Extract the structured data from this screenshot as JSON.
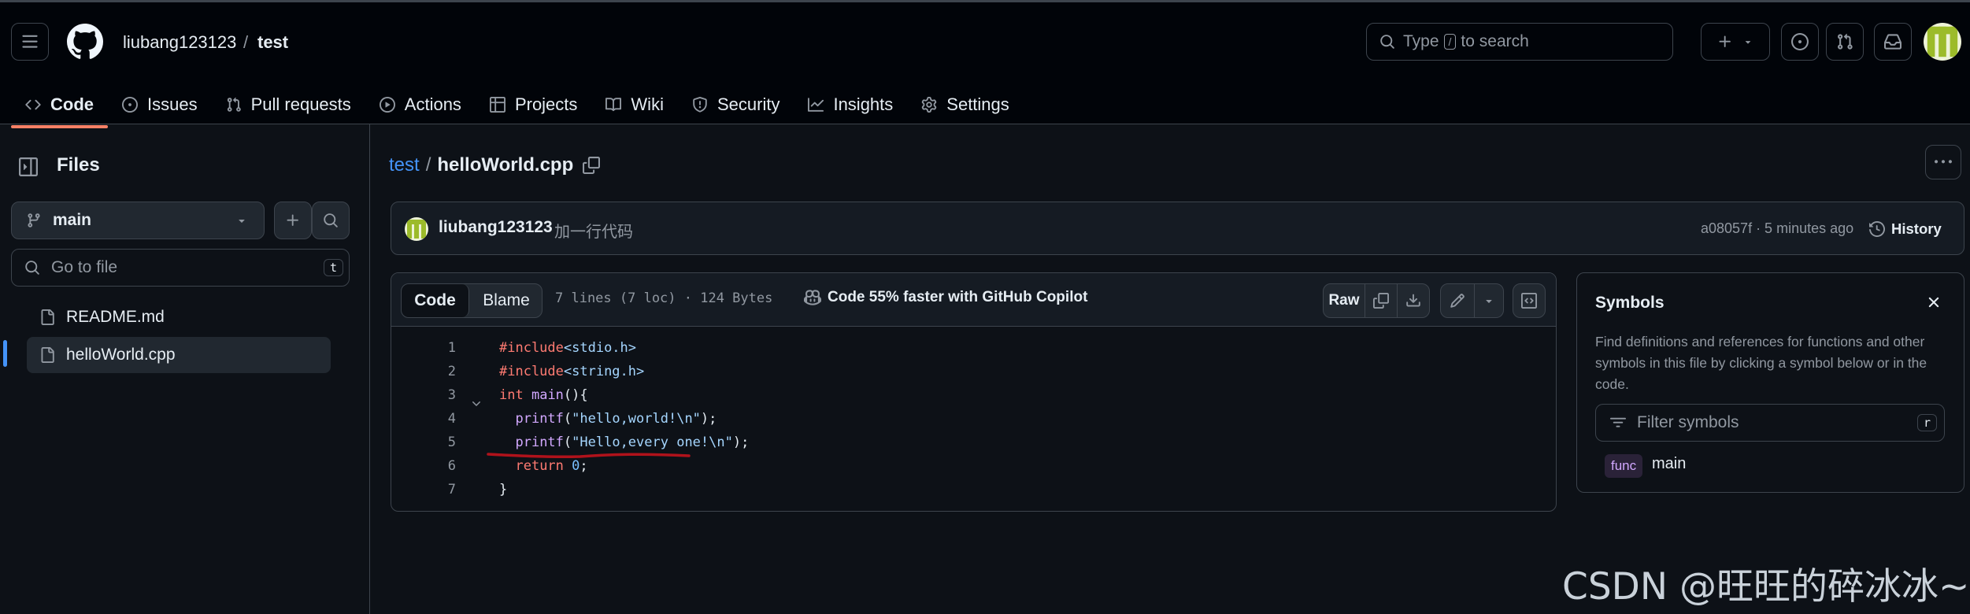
{
  "header": {
    "owner": "liubang123123",
    "separator": "/",
    "repo": "test",
    "search": {
      "prefix": "Type",
      "key": "/",
      "suffix": "to search"
    }
  },
  "tabs": [
    {
      "label": "Code",
      "icon": "code-icon",
      "active": true
    },
    {
      "label": "Issues",
      "icon": "issue-icon"
    },
    {
      "label": "Pull requests",
      "icon": "pull-request-icon"
    },
    {
      "label": "Actions",
      "icon": "play-icon"
    },
    {
      "label": "Projects",
      "icon": "table-icon"
    },
    {
      "label": "Wiki",
      "icon": "book-icon"
    },
    {
      "label": "Security",
      "icon": "shield-icon"
    },
    {
      "label": "Insights",
      "icon": "graph-icon"
    },
    {
      "label": "Settings",
      "icon": "gear-icon"
    }
  ],
  "sidebar": {
    "title": "Files",
    "branch": "main",
    "goto_placeholder": "Go to file",
    "goto_key": "t",
    "files": [
      {
        "name": "README.md",
        "active": false
      },
      {
        "name": "helloWorld.cpp",
        "active": true
      }
    ]
  },
  "path": {
    "repo": "test",
    "separator": "/",
    "file": "helloWorld.cpp"
  },
  "commit": {
    "author": "liubang123123",
    "message": "加一行代码",
    "hash_time": "a08057f · 5 minutes ago",
    "history_label": "History"
  },
  "code_view": {
    "tab_code": "Code",
    "tab_blame": "Blame",
    "meta": "7 lines (7 loc) · 124 Bytes",
    "copilot": "Code 55% faster with GitHub Copilot",
    "raw_label": "Raw",
    "lines": [
      {
        "n": "1",
        "tokens": [
          [
            "pp",
            "#include"
          ],
          [
            "hdr",
            "<stdio.h>"
          ]
        ]
      },
      {
        "n": "2",
        "tokens": [
          [
            "pp",
            "#include"
          ],
          [
            "hdr",
            "<string.h>"
          ]
        ]
      },
      {
        "n": "3",
        "tokens": [
          [
            "kw",
            "int"
          ],
          [
            "",
            " "
          ],
          [
            "fn",
            "main"
          ],
          [
            "",
            "(){"
          ]
        ]
      },
      {
        "n": "4",
        "tokens": [
          [
            "",
            "  "
          ],
          [
            "fn",
            "printf"
          ],
          [
            "",
            "("
          ],
          [
            "str",
            "\"hello,world!\\n\""
          ],
          [
            "",
            ");"
          ]
        ]
      },
      {
        "n": "5",
        "tokens": [
          [
            "",
            "  "
          ],
          [
            "fn",
            "printf"
          ],
          [
            "",
            "("
          ],
          [
            "str",
            "\"Hello,every one!\\n\""
          ],
          [
            "",
            ");"
          ]
        ]
      },
      {
        "n": "6",
        "tokens": [
          [
            "",
            "  "
          ],
          [
            "kw",
            "return"
          ],
          [
            "",
            " "
          ],
          [
            "num",
            "0"
          ],
          [
            "",
            ";"
          ]
        ]
      },
      {
        "n": "7",
        "tokens": [
          [
            "",
            "}"
          ]
        ]
      }
    ]
  },
  "symbols": {
    "title": "Symbols",
    "description": "Find definitions and references for functions and other symbols in this file by clicking a symbol below or in the code.",
    "filter_placeholder": "Filter symbols",
    "filter_key": "r",
    "items": [
      {
        "kind": "func",
        "name": "main"
      }
    ]
  },
  "watermark": "CSDN @旺旺的碎冰冰~",
  "colors": {
    "accent": "#4493f8",
    "active_tab_underline": "#f78166",
    "annotation": "#b0121b"
  }
}
